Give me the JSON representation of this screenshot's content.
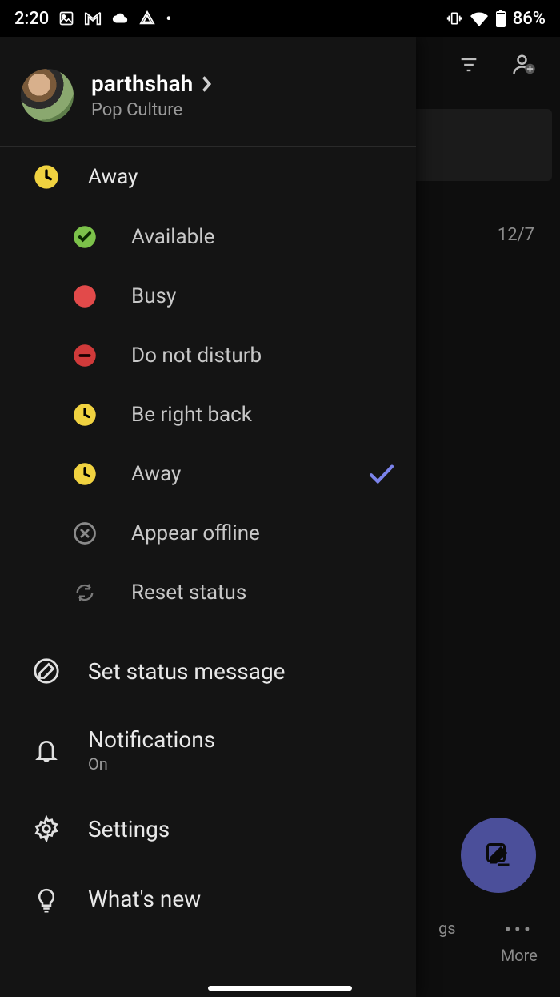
{
  "status_bar": {
    "time": "2:20",
    "battery": "86%"
  },
  "backdrop": {
    "date": "12/7",
    "more_label": "More",
    "partial_label": "gs"
  },
  "profile": {
    "username": "parthshah",
    "subtitle": "Pop Culture"
  },
  "current_status": {
    "label": "Away"
  },
  "status_options": [
    {
      "label": "Available"
    },
    {
      "label": "Busy"
    },
    {
      "label": "Do not disturb"
    },
    {
      "label": "Be right back"
    },
    {
      "label": "Away"
    },
    {
      "label": "Appear offline"
    },
    {
      "label": "Reset status"
    }
  ],
  "menu": {
    "set_status_message": "Set status message",
    "notifications": "Notifications",
    "notifications_sub": "On",
    "settings": "Settings",
    "whats_new": "What's new"
  }
}
